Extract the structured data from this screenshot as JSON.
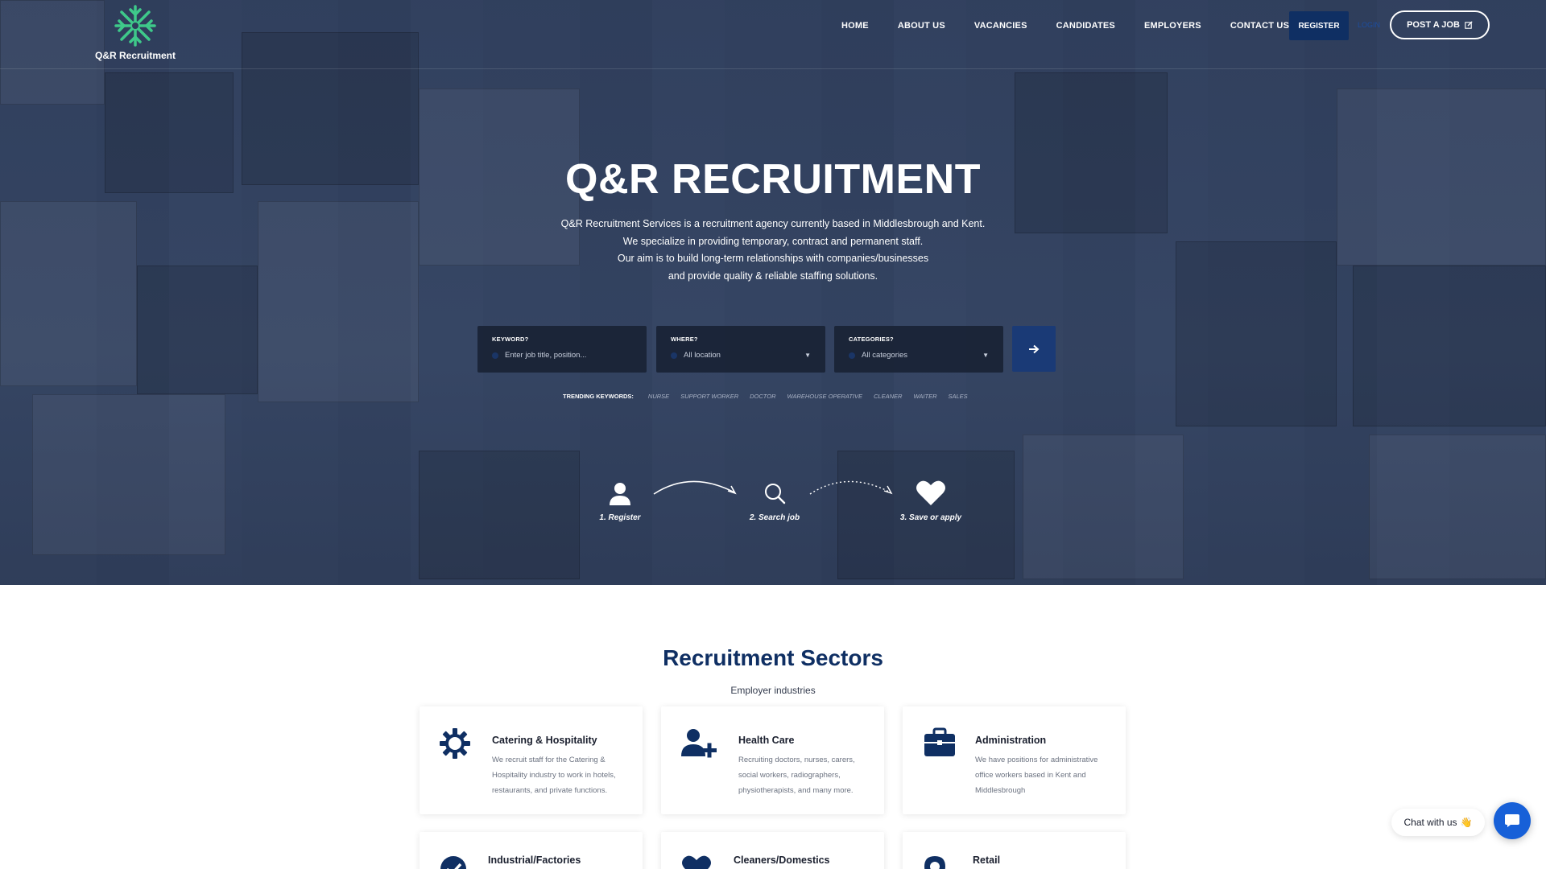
{
  "brand": {
    "name": "Q&R Recruitment",
    "accent": "#3ec98a",
    "navy": "#0f2f63"
  },
  "nav": {
    "items": [
      "HOME",
      "ABOUT US",
      "VACANCIES",
      "CANDIDATES",
      "EMPLOYERS",
      "CONTACT US"
    ],
    "register_label": "REGISTER",
    "login_label": "LOGIN",
    "post_job_label": "POST A JOB",
    "post_job_icon": "edit-icon"
  },
  "hero": {
    "title": "Q&R RECRUITMENT",
    "description": [
      "Q&R Recruitment Services is a recruitment agency currently based in Middlesbrough and Kent.",
      "We specialize in providing temporary, contract and permanent staff.",
      "Our aim is to build long-term relationships with companies/businesses",
      "and provide quality & reliable staffing solutions."
    ]
  },
  "search": {
    "keyword_label": "KEYWORD?",
    "keyword_placeholder": "Enter job title, position...",
    "where_label": "WHERE?",
    "where_value": "All location",
    "categories_label": "CATEGORIES?",
    "categories_value": "All categories",
    "submit_icon": "arrow-right-icon"
  },
  "trending": {
    "label": "TRENDING KEYWORDS:",
    "keywords": [
      "NURSE",
      "SUPPORT WORKER",
      "DOCTOR",
      "WAREHOUSE OPERATIVE",
      "CLEANER",
      "WAITER",
      "SALES"
    ]
  },
  "steps": [
    {
      "label": "1. Register",
      "icon": "user-icon"
    },
    {
      "label": "2. Search job",
      "icon": "search-icon"
    },
    {
      "label": "3. Save or apply",
      "icon": "heart-icon"
    }
  ],
  "sectors": {
    "title": "Recruitment Sectors",
    "subtitle": "Employer industries",
    "cards": [
      {
        "title": "Catering & Hospitality",
        "description": "We recruit staff for the Catering & Hospitality industry to work in hotels, restaurants, and private functions.",
        "icon": "gear-icon"
      },
      {
        "title": "Health Care",
        "description": "Recruiting doctors, nurses, carers, social workers, radiographers, physiotherapists, and many more.",
        "icon": "user-plus-icon"
      },
      {
        "title": "Administration",
        "description": "We have positions for administrative office workers based in Kent and Middlesbrough",
        "icon": "briefcase-icon"
      },
      {
        "title": "Industrial/Factories",
        "description": "",
        "icon": "check-circle-icon"
      },
      {
        "title": "Cleaners/Domestics",
        "description": "",
        "icon": "heart-icon"
      },
      {
        "title": "Retail",
        "description": "",
        "icon": "map-pin-icon"
      }
    ]
  },
  "chat": {
    "label": "Chat with us",
    "emoji": "👋",
    "icon": "chat-bubble-icon"
  }
}
